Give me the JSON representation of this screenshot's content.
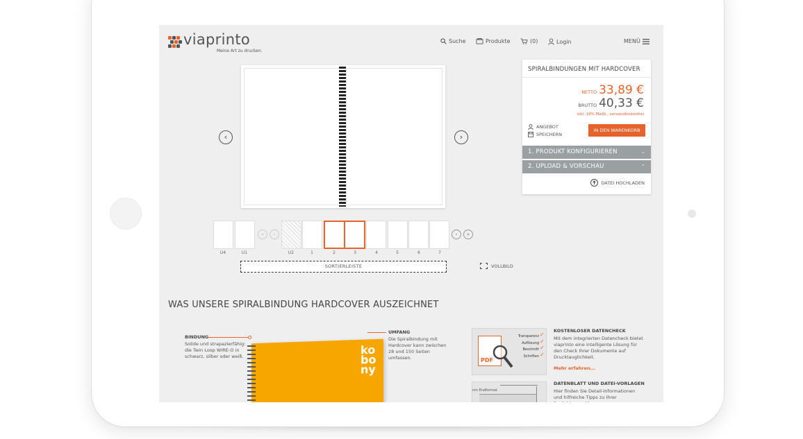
{
  "logo": {
    "name": "viaprinto",
    "tagline": "Meine Art zu drucken."
  },
  "nav": {
    "search": "Suche",
    "products": "Produkte",
    "cart": "(0)",
    "login": "Login",
    "menu": "MENÜ"
  },
  "thumbnails": {
    "labels": [
      "U4",
      "U1",
      "U2",
      "1",
      "2",
      "3",
      "4",
      "5",
      "6",
      "7"
    ]
  },
  "sortbar": "SORTIERLEISTE",
  "fullview": "VOLLBILD",
  "pricebox": {
    "title": "SPIRALBINDUNGEN MIT HARDCOVER",
    "netto_label": "NETTO",
    "netto_value": "33,89 €",
    "brutto_label": "BRUTTO",
    "brutto_value": "40,33 €",
    "tax_note": "inkl. 19% MwSt., versandkostenfrei",
    "offer": "ANGEBOT",
    "save": "SPEICHERN",
    "cart_button": "IN DEN WARENKORB",
    "step1": "1. PRODUKT KONFIGURIEREN",
    "step2": "2. UPLOAD & VORSCHAU",
    "upload": "DATEI HOCHLADEN"
  },
  "section": {
    "heading": "WAS UNSERE SPIRALBINDUNG HARDCOVER AUSZEICHNET",
    "binding_title": "BINDUNG",
    "binding_text": "Solide und strapazierfähig: die Twin Loop WIRE-O in schwarz, silber oder weiß.",
    "scope_title": "UMFANG",
    "scope_text": "Die Spiralbindung mit Hardcover kann zwischen 28 und 150 Seiten umfassen.",
    "cover_text": "ko bo ny",
    "check_title": "KOSTENLOSER DATENCHECK",
    "check_text": "Mit dem integrierten Datencheck bietet viaprinto eine intelligente Lösung für den Check Ihrer Dokumente auf Drucktauglichkeit.",
    "check_more": "Mehr erfahren...",
    "check_items": [
      "Transparenz",
      "Auflösung",
      "Beschnitt",
      "Schriften"
    ],
    "pdf_label": "PDF",
    "sheet_title": "DATENBLATT UND DATEI-VORLAGEN",
    "sheet_text": "Hier finden Sie Detail-Informationen und hilfreiche Tipps zu Ihrer Produktauswahl.",
    "sheet_img_label": "nm Endformat"
  },
  "colors": {
    "accent": "#e8622c",
    "accordion": "#9aa0a2",
    "cover": "#f7a600"
  }
}
